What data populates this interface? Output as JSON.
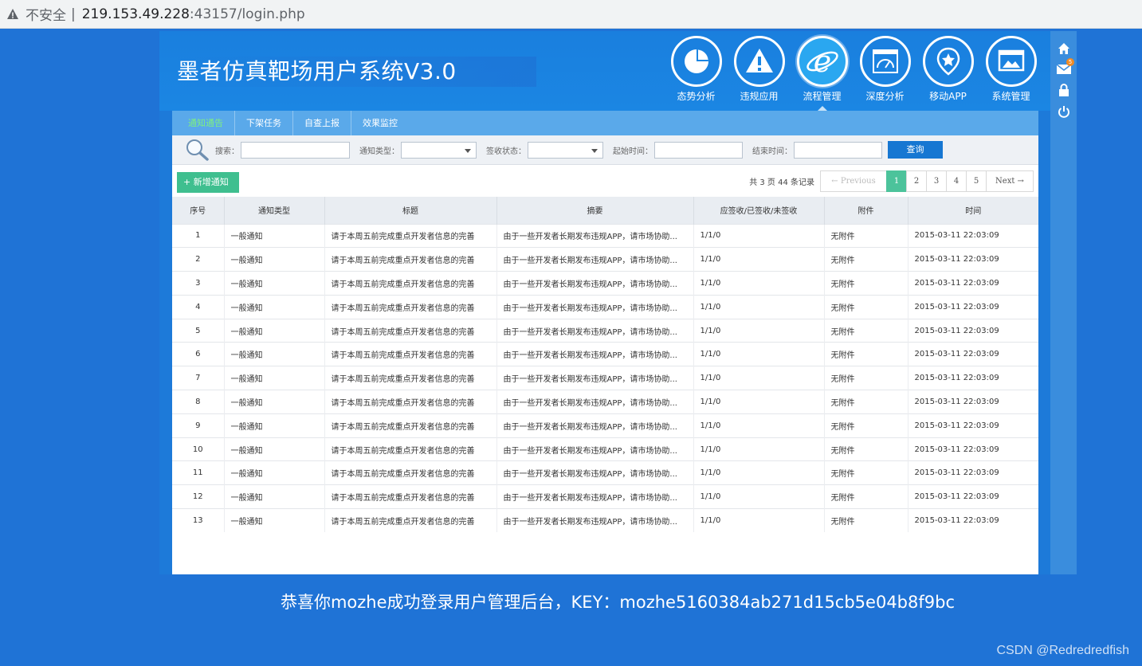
{
  "browser": {
    "insecure_label": "不安全",
    "separator": "|",
    "url_host": "219.153.49.228",
    "url_rest": ":43157/login.php"
  },
  "app": {
    "title": "墨者仿真靶场用户系统V3.0",
    "top_nav": [
      {
        "label": "态势分析",
        "icon": "pie-chart-icon"
      },
      {
        "label": "违规应用",
        "icon": "warning-icon"
      },
      {
        "label": "流程管理",
        "icon": "ie-icon",
        "active": true
      },
      {
        "label": "深度分析",
        "icon": "gauge-icon"
      },
      {
        "label": "移动APP",
        "icon": "star-badge-icon"
      },
      {
        "label": "系统管理",
        "icon": "monitor-icon"
      }
    ],
    "rail": {
      "mail_badge": "5",
      "icons": [
        "home-icon",
        "mail-icon",
        "lock-icon",
        "power-icon"
      ]
    },
    "sub_tabs": [
      "通知通告",
      "下架任务",
      "自查上报",
      "效果监控"
    ],
    "search": {
      "keyword_label": "搜索：",
      "type_label": "通知类型：",
      "status_label": "签收状态：",
      "start_label": "起始时间：",
      "end_label": "结束时间：",
      "query_button": "查询"
    },
    "add_button": "+ 新增通知",
    "pager": {
      "info": "共 3 页 44 条记录",
      "prev": "← Previous",
      "pages": [
        "1",
        "2",
        "3",
        "4",
        "5"
      ],
      "current": "1",
      "next": "Next →"
    },
    "table": {
      "headers": [
        "序号",
        "通知类型",
        "标题",
        "摘要",
        "应签收/已签收/未签收",
        "附件",
        "时间"
      ],
      "rows": [
        [
          "1",
          "一般通知",
          "请于本周五前完成重点开发者信息的完善",
          "由于一些开发者长期发布违规APP，请市场协助...",
          "1/1/0",
          "无附件",
          "2015-03-11 22:03:09"
        ],
        [
          "2",
          "一般通知",
          "请于本周五前完成重点开发者信息的完善",
          "由于一些开发者长期发布违规APP，请市场协助...",
          "1/1/0",
          "无附件",
          "2015-03-11 22:03:09"
        ],
        [
          "3",
          "一般通知",
          "请于本周五前完成重点开发者信息的完善",
          "由于一些开发者长期发布违规APP，请市场协助...",
          "1/1/0",
          "无附件",
          "2015-03-11 22:03:09"
        ],
        [
          "4",
          "一般通知",
          "请于本周五前完成重点开发者信息的完善",
          "由于一些开发者长期发布违规APP，请市场协助...",
          "1/1/0",
          "无附件",
          "2015-03-11 22:03:09"
        ],
        [
          "5",
          "一般通知",
          "请于本周五前完成重点开发者信息的完善",
          "由于一些开发者长期发布违规APP，请市场协助...",
          "1/1/0",
          "无附件",
          "2015-03-11 22:03:09"
        ],
        [
          "6",
          "一般通知",
          "请于本周五前完成重点开发者信息的完善",
          "由于一些开发者长期发布违规APP，请市场协助...",
          "1/1/0",
          "无附件",
          "2015-03-11 22:03:09"
        ],
        [
          "7",
          "一般通知",
          "请于本周五前完成重点开发者信息的完善",
          "由于一些开发者长期发布违规APP，请市场协助...",
          "1/1/0",
          "无附件",
          "2015-03-11 22:03:09"
        ],
        [
          "8",
          "一般通知",
          "请于本周五前完成重点开发者信息的完善",
          "由于一些开发者长期发布违规APP，请市场协助...",
          "1/1/0",
          "无附件",
          "2015-03-11 22:03:09"
        ],
        [
          "9",
          "一般通知",
          "请于本周五前完成重点开发者信息的完善",
          "由于一些开发者长期发布违规APP，请市场协助...",
          "1/1/0",
          "无附件",
          "2015-03-11 22:03:09"
        ],
        [
          "10",
          "一般通知",
          "请于本周五前完成重点开发者信息的完善",
          "由于一些开发者长期发布违规APP，请市场协助...",
          "1/1/0",
          "无附件",
          "2015-03-11 22:03:09"
        ],
        [
          "11",
          "一般通知",
          "请于本周五前完成重点开发者信息的完善",
          "由于一些开发者长期发布违规APP，请市场协助...",
          "1/1/0",
          "无附件",
          "2015-03-11 22:03:09"
        ],
        [
          "12",
          "一般通知",
          "请于本周五前完成重点开发者信息的完善",
          "由于一些开发者长期发布违规APP，请市场协助...",
          "1/1/0",
          "无附件",
          "2015-03-11 22:03:09"
        ],
        [
          "13",
          "一般通知",
          "请于本周五前完成重点开发者信息的完善",
          "由于一些开发者长期发布违规APP，请市场协助...",
          "1/1/0",
          "无附件",
          "2015-03-11 22:03:09"
        ]
      ]
    }
  },
  "key_message": "恭喜你mozhe成功登录用户管理后台，KEY：mozhe5160384ab271d15cb5e04b8f9bc",
  "watermark": "CSDN @Redredredfish",
  "colors": {
    "page_bg": "#1f73d6",
    "active_tab": "#7ff07f",
    "query_button": "#1677d2",
    "add_button": "#3fbf8f",
    "pager_current": "#4cc39b"
  }
}
